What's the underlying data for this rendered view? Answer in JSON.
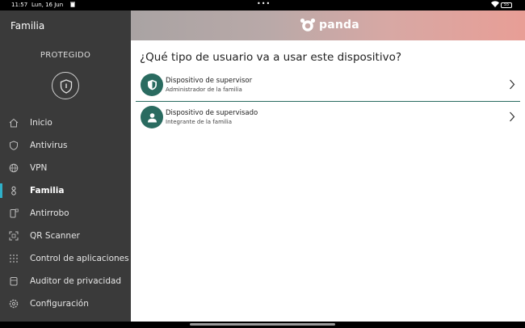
{
  "status_bar": {
    "time": "11:57",
    "date": "Lun, 16 Jun",
    "trash_icon": "trash-icon",
    "dots": "•••",
    "battery": "55"
  },
  "sidebar": {
    "title": "Familia",
    "protection_status": "PROTEGIDO",
    "items": [
      {
        "label": "Inicio",
        "icon": "home-icon"
      },
      {
        "label": "Antivirus",
        "icon": "shield-icon"
      },
      {
        "label": "VPN",
        "icon": "globe-icon"
      },
      {
        "label": "Familia",
        "icon": "family-icon",
        "active": true
      },
      {
        "label": "Antirrobo",
        "icon": "phone-lock-icon"
      },
      {
        "label": "QR Scanner",
        "icon": "qr-icon"
      },
      {
        "label": "Control de aplicaciones",
        "icon": "apps-grid-icon"
      },
      {
        "label": "Auditor de privacidad",
        "icon": "database-icon"
      },
      {
        "label": "Configuración",
        "icon": "gear-icon"
      }
    ],
    "accent_color": "#2fb0c9"
  },
  "main": {
    "logo_text": "panda",
    "question": "¿Qué tipo de usuario va a usar este dispositivo?",
    "options": [
      {
        "title": "Dispositivo de supervisor",
        "subtitle": "Administrador de la familia",
        "icon": "shield-icon"
      },
      {
        "title": "Dispositivo de supervisado",
        "subtitle": "Integrante de la familia",
        "icon": "person-icon"
      }
    ],
    "option_icon_color": "#2a6b60"
  }
}
